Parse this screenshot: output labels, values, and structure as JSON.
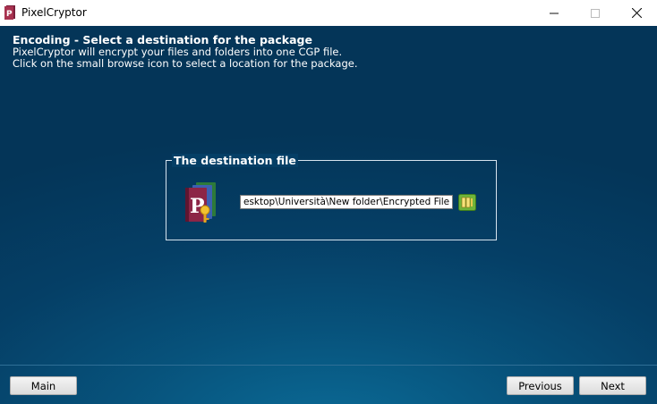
{
  "window": {
    "title": "PixelCryptor",
    "controls": {
      "minimize": "—",
      "maximize": "☐",
      "close": "✕"
    },
    "icons": {
      "app": "pixelcryptor-app-icon"
    }
  },
  "header": {
    "title": "Encoding - Select a destination for the package",
    "line1": "PixelCryptor will encrypt your files and folders into one CGP file.",
    "line2": "Click on the small browse icon to select a location for the package."
  },
  "destination": {
    "legend": "The destination file",
    "path_value": "esktop\\Università\\New folder\\Encrypted File.cgp",
    "icons": {
      "package": "package-icon",
      "browse": "folder-browse-icon"
    }
  },
  "footer": {
    "main_label": "Main",
    "previous_label": "Previous",
    "next_label": "Next"
  },
  "colors": {
    "background_dark": "#043558",
    "background_light": "#0b6c98",
    "groupbox_border": "#d6e3ee"
  }
}
